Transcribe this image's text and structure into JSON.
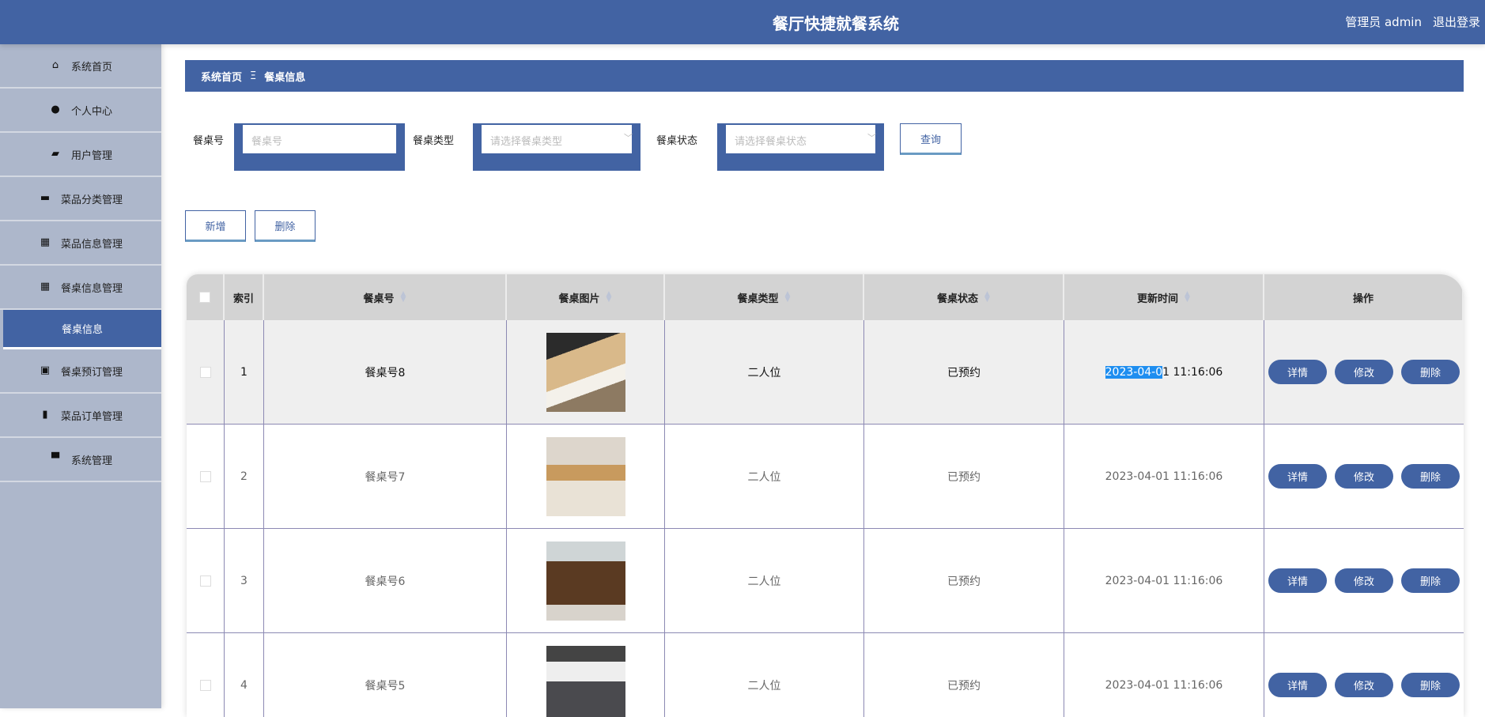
{
  "header": {
    "title": "餐厅快捷就餐系统",
    "user": "管理员 admin",
    "logout": "退出登录"
  },
  "sidebar": {
    "items": [
      {
        "label": "系统首页",
        "icon": "home-icon",
        "glyph": "⌂"
      },
      {
        "label": "个人中心",
        "icon": "user-icon",
        "glyph": "●"
      },
      {
        "label": "用户管理",
        "icon": "wallet-icon",
        "glyph": "▰"
      },
      {
        "label": "菜品分类管理",
        "icon": "briefcase-icon",
        "glyph": "▬"
      },
      {
        "label": "菜品信息管理",
        "icon": "grid-icon",
        "glyph": "▦"
      },
      {
        "label": "餐桌信息管理",
        "icon": "grid-icon",
        "glyph": "▦"
      },
      {
        "label": "餐桌信息",
        "icon": "",
        "glyph": "",
        "active": true
      },
      {
        "label": "餐桌预订管理",
        "icon": "clipboard-icon",
        "glyph": "▣"
      },
      {
        "label": "菜品订单管理",
        "icon": "book-icon",
        "glyph": "▮"
      },
      {
        "label": "系统管理",
        "icon": "chat-icon",
        "glyph": "▀"
      }
    ]
  },
  "breadcrumb": {
    "home": "系统首页",
    "sep": "Ξ",
    "current": "餐桌信息"
  },
  "filters": {
    "table_no_label": "餐桌号",
    "table_no_placeholder": "餐桌号",
    "type_label": "餐桌类型",
    "type_placeholder": "请选择餐桌类型",
    "status_label": "餐桌状态",
    "status_placeholder": "请选择餐桌状态",
    "query": "查询"
  },
  "toolbar": {
    "add": "新增",
    "delete": "删除"
  },
  "table": {
    "columns": [
      "索引",
      "餐桌号",
      "餐桌图片",
      "餐桌类型",
      "餐桌状态",
      "更新时间",
      "操作"
    ],
    "actions": [
      "详情",
      "修改",
      "删除"
    ],
    "rows": [
      {
        "index": "1",
        "no": "餐桌号8",
        "type": "二人位",
        "status": "已预约",
        "time_sel": "2023-04-0",
        "time_rest": "1 11:16:06"
      },
      {
        "index": "2",
        "no": "餐桌号7",
        "type": "二人位",
        "status": "已预约",
        "time": "2023-04-01 11:16:06"
      },
      {
        "index": "3",
        "no": "餐桌号6",
        "type": "二人位",
        "status": "已预约",
        "time": "2023-04-01 11:16:06"
      },
      {
        "index": "4",
        "no": "餐桌号5",
        "type": "二人位",
        "status": "已预约",
        "time": "2023-04-01 11:16:06"
      }
    ]
  }
}
